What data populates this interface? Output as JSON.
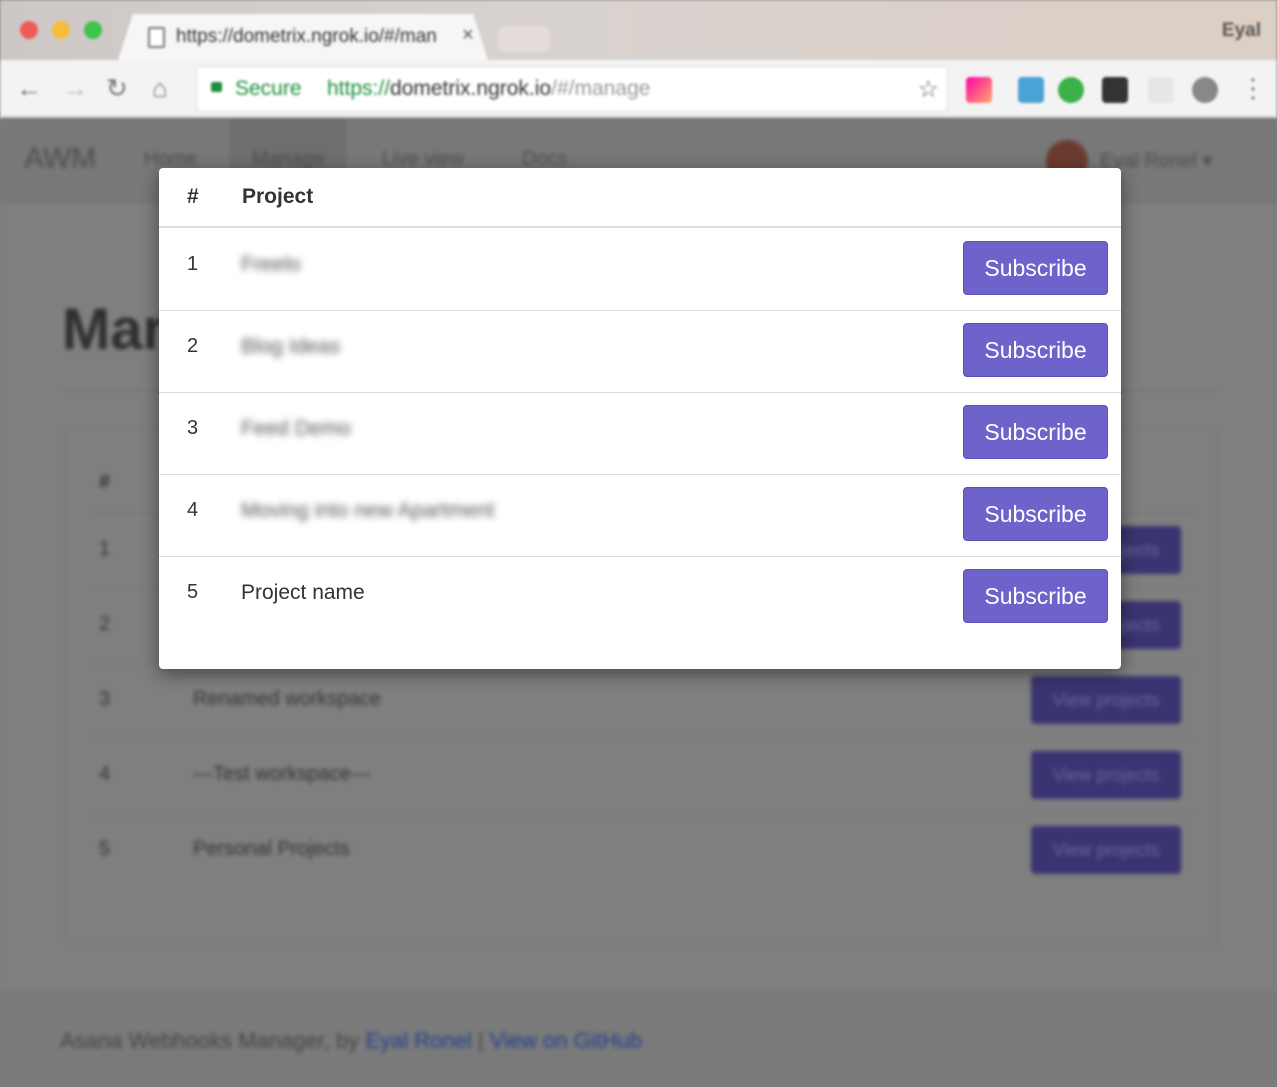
{
  "browser": {
    "tab_title": "https://dometrix.ngrok.io/#/manage",
    "tab_close": "×",
    "user": "Eyal",
    "secure_label": "Secure",
    "url_scheme": "https://",
    "url_host": "dometrix.ngrok.io",
    "url_path": "/#/manage",
    "back_icon": "←",
    "forward_icon": "→",
    "reload_icon": "↻",
    "home_icon": "⌂",
    "star_icon": "☆",
    "menu_icon": "⋮"
  },
  "navbar": {
    "brand": "AWM",
    "links": [
      "Home",
      "Manage",
      "Live view",
      "Docs"
    ],
    "active": "Manage",
    "profile_name": "Eyal Ronel",
    "caret": "▾"
  },
  "page": {
    "heading": "Manage",
    "table_hash": "#",
    "workspaces": [
      {
        "num": "1",
        "name": "",
        "button": "View projects"
      },
      {
        "num": "2",
        "name": "",
        "button": "View projects"
      },
      {
        "num": "3",
        "name": "Renamed workspace",
        "button": "View projects"
      },
      {
        "num": "4",
        "name": "---Test workspace---",
        "button": "View projects"
      },
      {
        "num": "5",
        "name": "Personal Projects",
        "button": "View projects"
      }
    ]
  },
  "footer": {
    "text": "Asana Webhooks Manager, by ",
    "author": "Eyal Ronel",
    "separator": " | ",
    "github": "View on GitHub"
  },
  "modal": {
    "col_hash": "#",
    "col_project": "Project",
    "rows": [
      {
        "num": "1",
        "name": "Freelo",
        "button": "Subscribe"
      },
      {
        "num": "2",
        "name": "Blog Ideas",
        "button": "Subscribe"
      },
      {
        "num": "3",
        "name": "Feed Demo",
        "button": "Subscribe"
      },
      {
        "num": "4",
        "name": "Moving into new Apartment",
        "button": "Subscribe"
      },
      {
        "num": "5",
        "name": "Project name",
        "button": "Subscribe"
      }
    ]
  },
  "colors": {
    "subscribe_button": "#6e63cb",
    "secure_green": "#1b8f3a",
    "backdrop": "#7f7f7f"
  }
}
